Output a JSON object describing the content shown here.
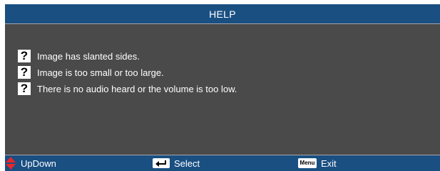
{
  "title": "HELP",
  "help_items": [
    {
      "icon": "question-mark-icon",
      "text": "Image has slanted sides."
    },
    {
      "icon": "question-mark-icon",
      "text": "Image is too small or too large."
    },
    {
      "icon": "question-mark-icon",
      "text": "There is no audio heard or the volume is too low."
    }
  ],
  "question_mark": "?",
  "footer": {
    "updown_label": "UpDown",
    "select_label": "Select",
    "exit_label": "Exit",
    "menu_key_label": "Menu"
  },
  "colors": {
    "title_bar": "#1a4f82",
    "panel": "#4a4a4a",
    "divider": "#a6a6a6",
    "updown_arrows": "#e8262c"
  }
}
